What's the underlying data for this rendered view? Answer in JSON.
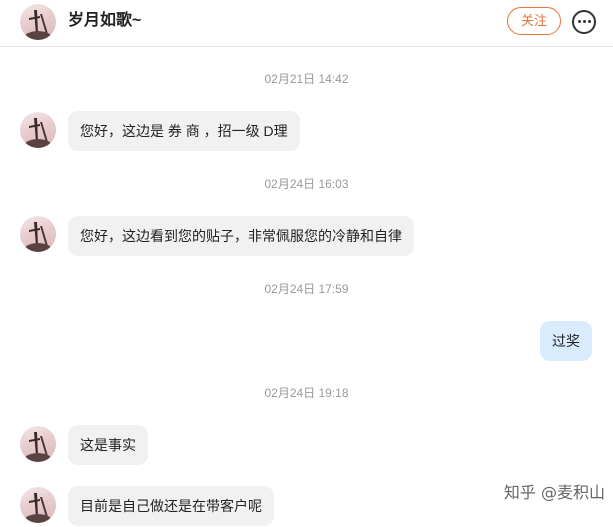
{
  "header": {
    "title": "岁月如歌~",
    "follow_label": "关注"
  },
  "messages": [
    {
      "time": "02月21日 14:42",
      "text": "您好，这边是  券  商 ，招一级  D理",
      "side": "left"
    },
    {
      "time": "02月24日 16:03",
      "text": "您好，这边看到您的贴子，非常佩服您的冷静和自律",
      "side": "left"
    },
    {
      "time": "02月24日 17:59",
      "text": "过奖",
      "side": "right"
    },
    {
      "time": "02月24日 19:18",
      "text": "这是事实",
      "side": "left"
    },
    {
      "time": "",
      "text": "目前是自己做还是在带客户呢",
      "side": "left"
    }
  ],
  "watermark": "知乎 @麦积山",
  "icons": {
    "more": "more-horizontal-icon",
    "avatar": "avatar-image"
  }
}
